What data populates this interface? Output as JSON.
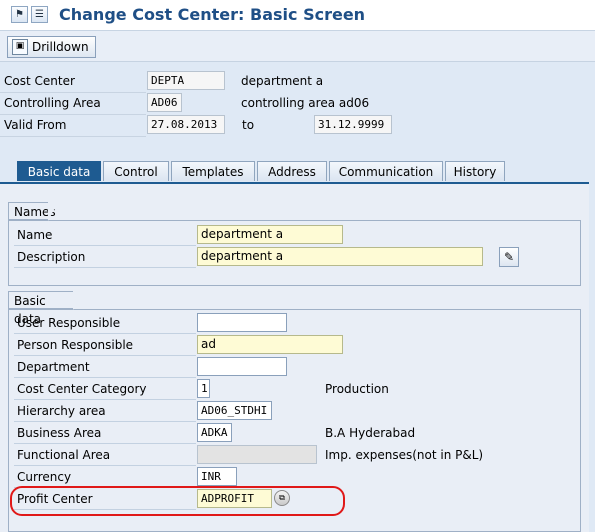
{
  "title": "Change Cost Center: Basic Screen",
  "toolbar": {
    "drilldown_label": "Drilldown"
  },
  "header": {
    "cost_center_label": "Cost Center",
    "cost_center_value": "DEPTA",
    "cost_center_desc": "department a",
    "controlling_area_label": "Controlling Area",
    "controlling_area_value": "AD06",
    "controlling_area_desc": "controlling area ad06",
    "valid_from_label": "Valid From",
    "valid_from_value": "27.08.2013",
    "to_label": "to",
    "valid_to_value": "31.12.9999"
  },
  "tabs": [
    "Basic data",
    "Control",
    "Templates",
    "Address",
    "Communication",
    "History"
  ],
  "names": {
    "group_title": "Names",
    "name_label": "Name",
    "name_value": "department a",
    "description_label": "Description",
    "description_value": "department a"
  },
  "basic": {
    "group_title": "Basic data",
    "user_responsible_label": "User Responsible",
    "user_responsible_value": "",
    "person_responsible_label": "Person Responsible",
    "person_responsible_value": "ad",
    "department_label": "Department",
    "department_value": "",
    "category_label": "Cost Center Category",
    "category_value": "1",
    "category_desc": "Production",
    "hierarchy_label": "Hierarchy area",
    "hierarchy_value": "AD06_STDHI",
    "business_area_label": "Business Area",
    "business_area_value": "ADKA",
    "business_area_desc": "B.A Hyderabad",
    "functional_area_label": "Functional Area",
    "functional_area_value": "",
    "functional_area_desc": "Imp. expenses(not in P&L)",
    "currency_label": "Currency",
    "currency_value": "INR",
    "profit_center_label": "Profit Center",
    "profit_center_value": "ADPROFIT"
  },
  "colors": {
    "accent": "#1e5b91",
    "title": "#1f4f86",
    "highlight": "#e01818"
  }
}
